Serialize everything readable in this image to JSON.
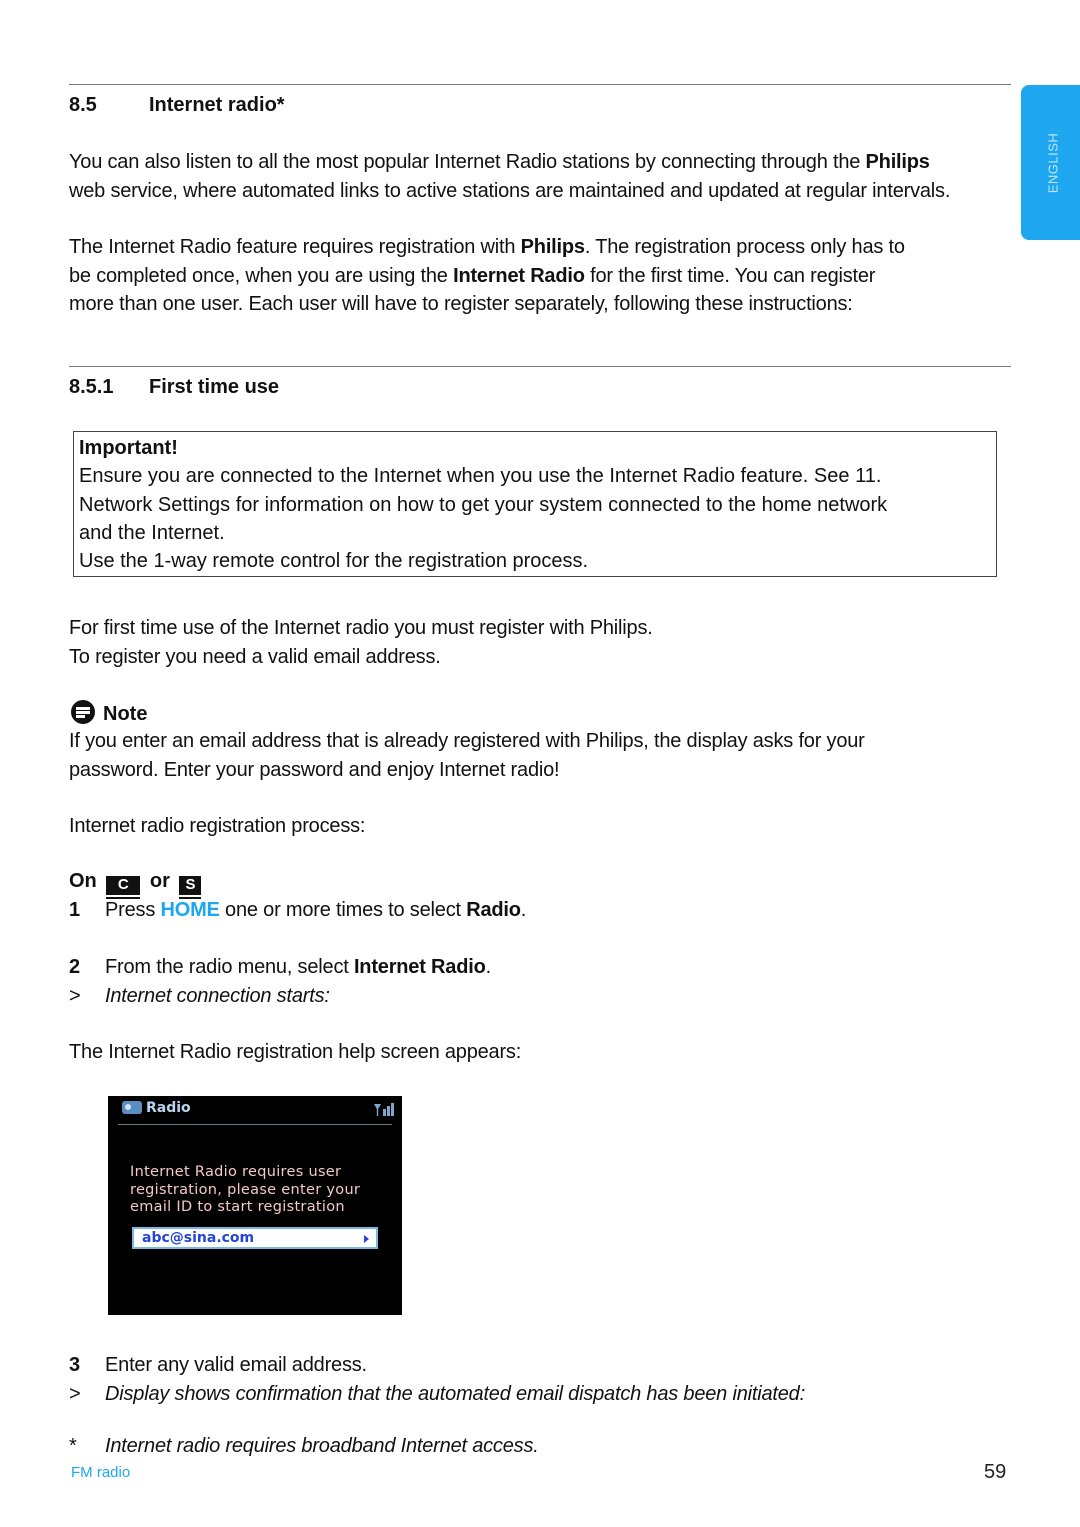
{
  "side_tab": {
    "label": "ENGLISH",
    "color": "#1ea7f0"
  },
  "section": {
    "number": "8.5",
    "title": "Internet radio*",
    "intro_p1": {
      "before": "You can also listen to all the most popular Internet Radio stations by connecting through the ",
      "bold": "Philips",
      "after": "web service, where automated links to active stations are maintained and updated at regular intervals."
    },
    "intro_p2": {
      "t1": "The Internet Radio feature requires registration with ",
      "b1": "Philips",
      "t2": ". The registration process only has to",
      "t3": "be completed once, when you are using the ",
      "b2": "Internet Radio",
      "t4": " for the first time. You can register",
      "t5": "more than one user. Each user will have to register separately, following these instructions:"
    }
  },
  "subsection": {
    "number": "8.5.1",
    "title": "First time use",
    "important": {
      "title": "Important!",
      "lines": [
        "Ensure you are connected to the Internet when you use the Internet Radio feature. See 11.",
        "Network Settings for information on how to get your system connected to the home network",
        "and the Internet.",
        "Use the 1-way remote control for the registration process."
      ]
    },
    "first_use_lines": [
      "For first time use of the Internet radio you must register with Philips.",
      "To register you need a valid email address."
    ],
    "note": {
      "title": "Note",
      "lines": [
        "If you enter an email address that is already registered with Philips, the display asks for your",
        "password. Enter your password and enjoy Internet radio!"
      ]
    },
    "process_label": "Internet radio registration process:",
    "on_line": {
      "on": "On",
      "key1": "C",
      "or": "or",
      "key2": "S"
    },
    "steps": [
      {
        "num": "1",
        "t1": "Press ",
        "highlight": "HOME",
        "t2": " one or more times to select ",
        "bold": "Radio",
        "t3": "."
      },
      {
        "num": "2",
        "t1": "From the radio menu, select ",
        "bold": "Internet Radio",
        "t2": ".",
        "result_marker": ">",
        "result": "Internet connection starts:"
      },
      {
        "num": "3",
        "text": "Enter any valid email address.",
        "result_marker": ">",
        "result": "Display shows confirmation that the automated email dispatch has been initiated:"
      }
    ],
    "help_screen_label": "The Internet Radio registration help screen appears:",
    "device_screen": {
      "header": "Radio",
      "message_lines": [
        "Internet Radio requires user",
        "registration, please enter your",
        "email ID to start registration"
      ],
      "email_value": "abc@sina.com"
    },
    "footnote": {
      "marker": "*",
      "text": "Internet radio requires broadband Internet access."
    }
  },
  "footer": {
    "chapter": "FM radio",
    "page": "59"
  }
}
